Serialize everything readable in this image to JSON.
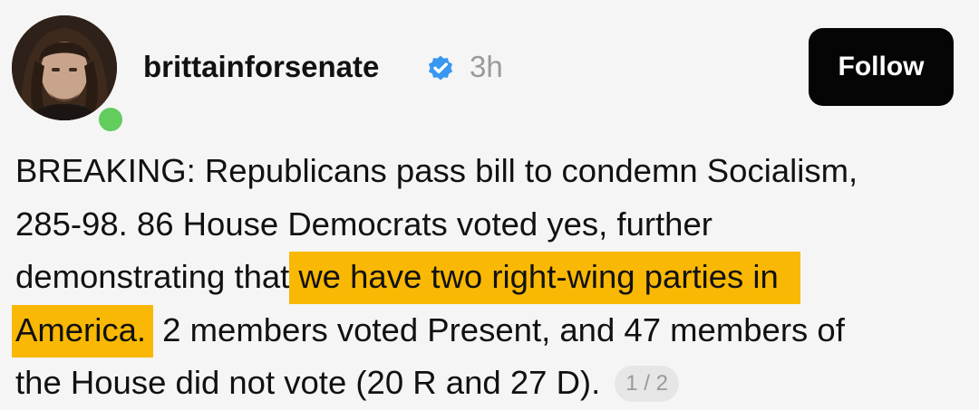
{
  "post": {
    "author": {
      "username": "brittainforsenate",
      "verified_icon": "verified-badge-icon",
      "verified_color": "#3897f0",
      "online_status_color": "#62cc5c"
    },
    "timestamp": "3h",
    "follow_label": "Follow",
    "text": {
      "line1": "BREAKING: Republicans pass bill to condemn Socialism,",
      "line2": "285-98. 86 House Democrats voted yes, further",
      "line3_plain": "demonstrating that",
      "line3_highlight": "we have two right-wing parties in",
      "line4_highlight": "America.",
      "line4_plain": "2 members voted Present, and 47 members of",
      "line5": "the House did not vote (20 R and 27 D)."
    },
    "highlight_color": "#f9b804",
    "page_indicator": "1 / 2"
  }
}
